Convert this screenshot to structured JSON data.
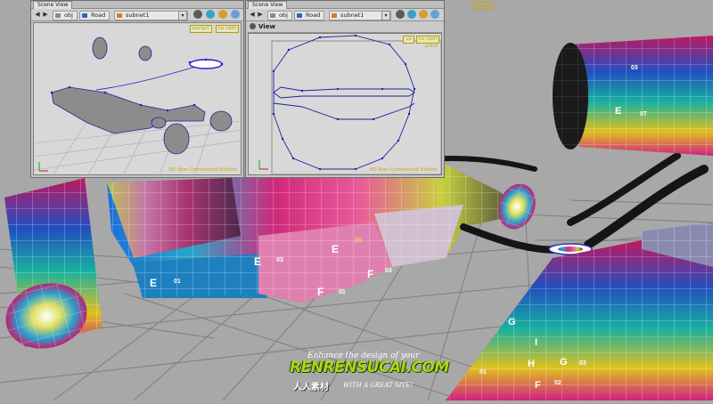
{
  "colors": {
    "viewport_bg": "#a8a8a8",
    "hd_watermark": "#c9a800",
    "curve_blue": "#2020c8",
    "watermark_green": "#a8d81a"
  },
  "persp_main_tag": "persp",
  "left_pane": {
    "tab": "Scene View",
    "path": [
      "obj",
      "Road",
      "subnet1"
    ],
    "viewport_menu": [
      "persp1",
      "no cam"
    ],
    "edition": "HD Non-Commercial Edition",
    "icons": [
      "back-arrow-icon",
      "forward-arrow-icon",
      "pin-icon",
      "display-icon",
      "snapshot-icon",
      "help-icon"
    ]
  },
  "right_pane": {
    "tab": "Scene View",
    "path": [
      "obj",
      "Road",
      "subnet1"
    ],
    "view_title": "View",
    "viewport_menu": [
      "uv",
      "no cam"
    ],
    "point_label": "point",
    "edition": "HD Non-Commercial Edition"
  },
  "uv_tile_labels": [
    "E",
    "01",
    "E",
    "03",
    "E",
    "05",
    "F",
    "01",
    "F",
    "03",
    "E",
    "07",
    "03",
    "G",
    "01",
    "I",
    "H",
    "G",
    "03",
    "F",
    "02"
  ],
  "watermark": {
    "tagline_top": "Enhance the design of your",
    "brand": "RENRENSUCAI.COM",
    "chinese": "人人素材",
    "tagline_bottom": "WITH A GREAT SITE!"
  }
}
